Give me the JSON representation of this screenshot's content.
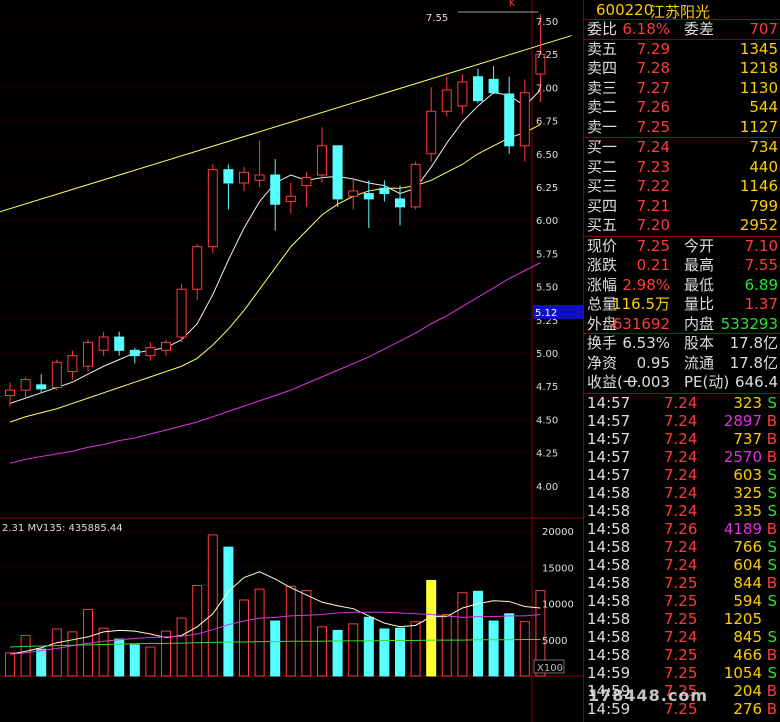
{
  "chart": {
    "price_axis": [
      "7.50",
      "7.25",
      "7.00",
      "6.75",
      "6.50",
      "6.25",
      "6.00",
      "5.75",
      "5.50",
      "5.25",
      "5.00",
      "4.75",
      "4.50",
      "4.25",
      "4.00"
    ],
    "volume_axis": [
      "20000",
      "15000",
      "10000",
      "5000"
    ],
    "high_marker": "7.55",
    "cursor_price": "5.12",
    "volume_header": "2.31  MV135: 435885.44",
    "multiplier": "X100",
    "corner_mark": "K",
    "watermark": "178448.com"
  },
  "chart_data": {
    "type": "candlestick",
    "candles": [
      {
        "o": 4.68,
        "h": 4.78,
        "l": 4.6,
        "c": 4.72
      },
      {
        "o": 4.72,
        "h": 4.82,
        "l": 4.66,
        "c": 4.8
      },
      {
        "o": 4.76,
        "h": 4.84,
        "l": 4.7,
        "c": 4.73
      },
      {
        "o": 4.74,
        "h": 4.95,
        "l": 4.72,
        "c": 4.93
      },
      {
        "o": 4.86,
        "h": 5.02,
        "l": 4.8,
        "c": 4.98
      },
      {
        "o": 4.9,
        "h": 5.1,
        "l": 4.86,
        "c": 5.08
      },
      {
        "o": 5.02,
        "h": 5.16,
        "l": 4.98,
        "c": 5.12
      },
      {
        "o": 5.12,
        "h": 5.16,
        "l": 4.98,
        "c": 5.02
      },
      {
        "o": 5.02,
        "h": 5.04,
        "l": 4.92,
        "c": 4.98
      },
      {
        "o": 4.98,
        "h": 5.08,
        "l": 4.94,
        "c": 5.04
      },
      {
        "o": 5.02,
        "h": 5.1,
        "l": 4.98,
        "c": 5.08
      },
      {
        "o": 5.12,
        "h": 5.52,
        "l": 5.08,
        "c": 5.48
      },
      {
        "o": 5.48,
        "h": 5.82,
        "l": 5.4,
        "c": 5.8
      },
      {
        "o": 5.8,
        "h": 6.42,
        "l": 5.75,
        "c": 6.38
      },
      {
        "o": 6.38,
        "h": 6.42,
        "l": 6.08,
        "c": 6.28
      },
      {
        "o": 6.28,
        "h": 6.4,
        "l": 6.22,
        "c": 6.36
      },
      {
        "o": 6.3,
        "h": 6.6,
        "l": 6.25,
        "c": 6.34
      },
      {
        "o": 6.34,
        "h": 6.46,
        "l": 5.92,
        "c": 6.12
      },
      {
        "o": 6.14,
        "h": 6.28,
        "l": 6.05,
        "c": 6.18
      },
      {
        "o": 6.26,
        "h": 6.36,
        "l": 6.1,
        "c": 6.32
      },
      {
        "o": 6.34,
        "h": 6.7,
        "l": 6.28,
        "c": 6.56
      },
      {
        "o": 6.56,
        "h": 6.56,
        "l": 6.1,
        "c": 6.16
      },
      {
        "o": 6.18,
        "h": 6.32,
        "l": 6.08,
        "c": 6.22
      },
      {
        "o": 6.2,
        "h": 6.3,
        "l": 5.94,
        "c": 6.16
      },
      {
        "o": 6.24,
        "h": 6.3,
        "l": 6.14,
        "c": 6.2
      },
      {
        "o": 6.16,
        "h": 6.26,
        "l": 5.96,
        "c": 6.1
      },
      {
        "o": 6.1,
        "h": 6.44,
        "l": 6.08,
        "c": 6.42
      },
      {
        "o": 6.5,
        "h": 7.0,
        "l": 6.44,
        "c": 6.82
      },
      {
        "o": 6.82,
        "h": 7.08,
        "l": 6.78,
        "c": 6.98
      },
      {
        "o": 6.86,
        "h": 7.1,
        "l": 6.8,
        "c": 7.04
      },
      {
        "o": 7.08,
        "h": 7.14,
        "l": 6.88,
        "c": 6.9
      },
      {
        "o": 7.06,
        "h": 7.16,
        "l": 6.95,
        "c": 6.96
      },
      {
        "o": 6.95,
        "h": 7.08,
        "l": 6.5,
        "c": 6.56
      },
      {
        "o": 6.56,
        "h": 7.06,
        "l": 6.44,
        "c": 6.96
      },
      {
        "o": 7.1,
        "h": 7.55,
        "l": 6.89,
        "c": 7.25
      }
    ],
    "volumes": [
      3200,
      5600,
      3700,
      6500,
      6100,
      9200,
      6600,
      5100,
      4300,
      4000,
      6200,
      8000,
      12500,
      19500,
      17800,
      10500,
      12000,
      7600,
      12400,
      11800,
      6800,
      6300,
      7200,
      8100,
      6500,
      6600,
      7500,
      13200,
      8500,
      11500,
      11700,
      7600,
      8600,
      7500,
      11800
    ],
    "highlight_volume_index": 27,
    "ma5": [
      4.62,
      4.66,
      4.7,
      4.74,
      4.78,
      4.84,
      4.9,
      4.95,
      5.0,
      5.02,
      5.04,
      5.1,
      5.22,
      5.44,
      5.7,
      5.94,
      6.14,
      6.28,
      6.34,
      6.3,
      6.32,
      6.33,
      6.31,
      6.28,
      6.26,
      6.2,
      6.24,
      6.4,
      6.58,
      6.74,
      6.86,
      6.96,
      6.94,
      6.86,
      6.98
    ],
    "ma10": [
      4.48,
      4.52,
      4.55,
      4.58,
      4.62,
      4.66,
      4.7,
      4.74,
      4.78,
      4.82,
      4.86,
      4.9,
      4.96,
      5.06,
      5.18,
      5.32,
      5.48,
      5.64,
      5.8,
      5.92,
      6.04,
      6.12,
      6.18,
      6.22,
      6.24,
      6.24,
      6.26,
      6.3,
      6.36,
      6.42,
      6.5,
      6.56,
      6.62,
      6.66,
      6.72
    ],
    "ma30": [
      4.17,
      4.2,
      4.22,
      4.24,
      4.26,
      4.29,
      4.31,
      4.34,
      4.36,
      4.39,
      4.42,
      4.45,
      4.48,
      4.52,
      4.56,
      4.6,
      4.64,
      4.68,
      4.72,
      4.77,
      4.82,
      4.87,
      4.92,
      4.97,
      5.03,
      5.09,
      5.15,
      5.22,
      5.28,
      5.35,
      5.42,
      5.49,
      5.56,
      5.62,
      5.68
    ],
    "trendline": [
      [
        -1,
        6.05
      ],
      [
        36,
        7.39
      ]
    ],
    "vol_ma5": [
      3000,
      3400,
      3900,
      4600,
      5000,
      5400,
      6100,
      6300,
      6200,
      5800,
      5300,
      5600,
      6800,
      8600,
      11700,
      13600,
      14400,
      13400,
      12200,
      11200,
      10200,
      9700,
      9300,
      8300,
      7300,
      6800,
      7000,
      8200,
      8200,
      9400,
      10000,
      10400,
      10300,
      9600,
      9400
    ],
    "vol_ma10": [
      3000,
      3200,
      3500,
      3800,
      4200,
      4500,
      4800,
      5000,
      5200,
      5300,
      5400,
      5500,
      5800,
      6400,
      7100,
      7600,
      8000,
      8100,
      8300,
      8400,
      8500,
      8700,
      8800,
      8800,
      8800,
      8700,
      8600,
      8500,
      8300,
      8100,
      8200,
      8200,
      8300,
      8300,
      8500
    ],
    "vol_ma135": [
      4000,
      4100,
      4150,
      4200,
      4250,
      4300,
      4350,
      4400,
      4450,
      4500,
      4500,
      4550,
      4600,
      4650,
      4700,
      4700,
      4750,
      4750,
      4800,
      4800,
      4800,
      4850,
      4850,
      4850,
      4900,
      4900,
      4900,
      4950,
      4950,
      4950,
      5000,
      5000,
      5000,
      5050,
      5050
    ],
    "price_range": [
      3.78,
      7.62
    ],
    "volume_range": [
      0,
      21000
    ]
  },
  "panel": {
    "code": "600220",
    "name": "江苏阳光",
    "wb": {
      "l1": "委比",
      "v1": "6.18%",
      "l2": "委差",
      "v2": "707"
    },
    "asks": [
      {
        "label": "卖五",
        "price": "7.29",
        "vol": "1345"
      },
      {
        "label": "卖四",
        "price": "7.28",
        "vol": "1218"
      },
      {
        "label": "卖三",
        "price": "7.27",
        "vol": "1130"
      },
      {
        "label": "卖二",
        "price": "7.26",
        "vol": "544"
      },
      {
        "label": "卖一",
        "price": "7.25",
        "vol": "1127"
      }
    ],
    "bids": [
      {
        "label": "买一",
        "price": "7.24",
        "vol": "734"
      },
      {
        "label": "买二",
        "price": "7.23",
        "vol": "440"
      },
      {
        "label": "买三",
        "price": "7.22",
        "vol": "1146"
      },
      {
        "label": "买四",
        "price": "7.21",
        "vol": "799"
      },
      {
        "label": "买五",
        "price": "7.20",
        "vol": "2952"
      }
    ],
    "stats1": [
      {
        "l1": "现价",
        "v1": "7.25",
        "c1": "red",
        "l2": "今开",
        "v2": "7.10",
        "c2": "red"
      },
      {
        "l1": "涨跌",
        "v1": "0.21",
        "c1": "red",
        "l2": "最高",
        "v2": "7.55",
        "c2": "red"
      },
      {
        "l1": "涨幅",
        "v1": "2.98%",
        "c1": "red",
        "l2": "最低",
        "v2": "6.89",
        "c2": "green"
      },
      {
        "l1": "总量",
        "v1": "116.5万",
        "c1": "yel",
        "l2": "量比",
        "v2": "1.37",
        "c2": "red"
      }
    ],
    "outin": {
      "l1": "外盘",
      "v1": "631692",
      "l2": "内盘",
      "v2": "533293"
    },
    "stats2": [
      {
        "l1": "换手",
        "v1": "6.53%",
        "l2": "股本",
        "v2": "17.8亿"
      },
      {
        "l1": "净资",
        "v1": "0.95",
        "l2": "流通",
        "v2": "17.8亿"
      },
      {
        "l1": "收益(一",
        "v1": "0.003",
        "l2": "PE(动)",
        "v2": "646.4"
      }
    ],
    "ticks": [
      {
        "t": "14:57",
        "p": "7.24",
        "q": "323",
        "d": "S"
      },
      {
        "t": "14:57",
        "p": "7.24",
        "q": "2897",
        "d": "B"
      },
      {
        "t": "14:57",
        "p": "7.24",
        "q": "737",
        "d": "B"
      },
      {
        "t": "14:57",
        "p": "7.24",
        "q": "2570",
        "d": "B"
      },
      {
        "t": "14:57",
        "p": "7.24",
        "q": "603",
        "d": "S"
      },
      {
        "t": "14:58",
        "p": "7.24",
        "q": "325",
        "d": "S"
      },
      {
        "t": "14:58",
        "p": "7.24",
        "q": "335",
        "d": "S"
      },
      {
        "t": "14:58",
        "p": "7.26",
        "q": "4189",
        "d": "B"
      },
      {
        "t": "14:58",
        "p": "7.24",
        "q": "766",
        "d": "S"
      },
      {
        "t": "14:58",
        "p": "7.24",
        "q": "604",
        "d": "S"
      },
      {
        "t": "14:58",
        "p": "7.25",
        "q": "844",
        "d": "B"
      },
      {
        "t": "14:58",
        "p": "7.25",
        "q": "594",
        "d": "S"
      },
      {
        "t": "14:58",
        "p": "7.25",
        "q": "1205",
        "d": ""
      },
      {
        "t": "14:58",
        "p": "7.24",
        "q": "845",
        "d": "S"
      },
      {
        "t": "14:58",
        "p": "7.25",
        "q": "466",
        "d": "B"
      },
      {
        "t": "14:59",
        "p": "7.25",
        "q": "1054",
        "d": "S"
      },
      {
        "t": "14:59",
        "p": "7.25",
        "q": "204",
        "d": "B"
      },
      {
        "t": "14:59",
        "p": "7.25",
        "q": "276",
        "d": "B"
      }
    ]
  }
}
